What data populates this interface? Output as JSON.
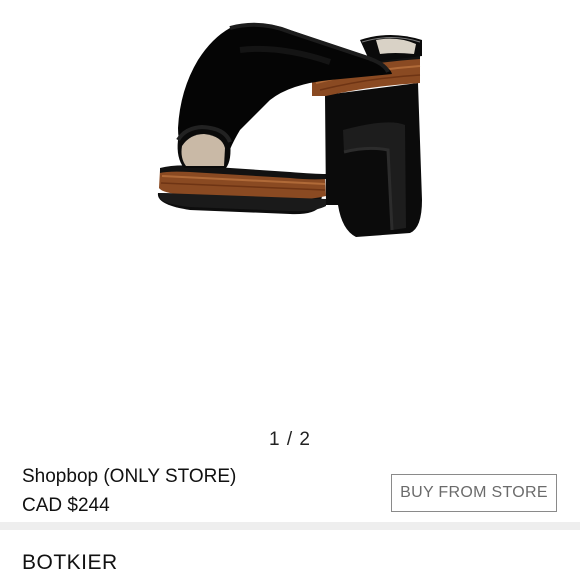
{
  "gallery": {
    "image_subject": "black-suede-platform-mule",
    "current_page": 1,
    "total_pages": 2,
    "pager_text": "1 / 2"
  },
  "store": {
    "name": "Shopbop (ONLY STORE)",
    "price": "CAD $244",
    "buy_label": "BUY FROM STORE"
  },
  "product": {
    "brand": "BOTKIER"
  },
  "colors": {
    "button_border": "#8a8a8a",
    "button_text": "#6b6b6b",
    "divider": "#eeeeee"
  }
}
